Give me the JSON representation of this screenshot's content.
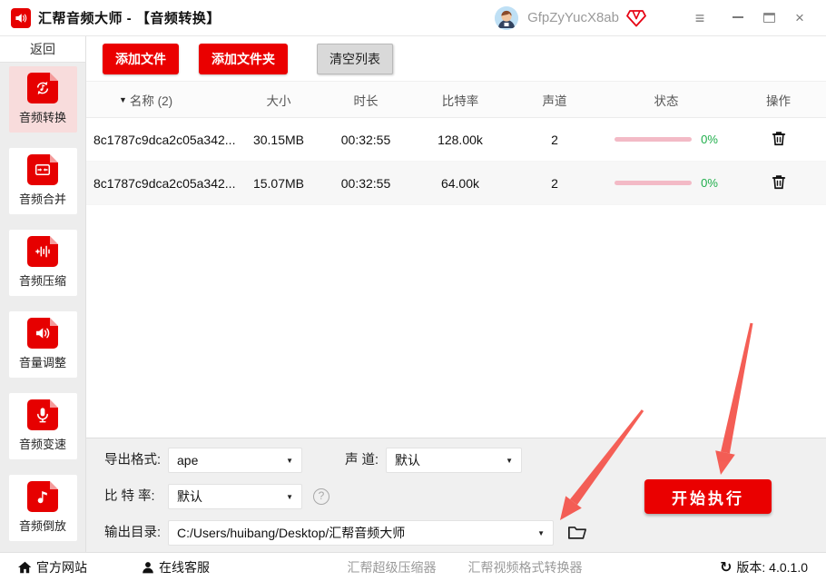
{
  "titlebar": {
    "app_title": "汇帮音频大师 - 【音频转换】",
    "username": "GfpZyYucX8ab"
  },
  "icons": {
    "menu": "≡",
    "close": "×",
    "sort_desc": "▼",
    "dropdown_caret": "▼",
    "help": "?",
    "refresh": "↻"
  },
  "sidebar": {
    "back_label": "返回",
    "items": [
      {
        "label": "音频转换",
        "active": true
      },
      {
        "label": "音频合并",
        "active": false
      },
      {
        "label": "音频压缩",
        "active": false
      },
      {
        "label": "音量调整",
        "active": false
      },
      {
        "label": "音频变速",
        "active": false
      },
      {
        "label": "音频倒放",
        "active": false
      }
    ]
  },
  "toolbar": {
    "add_file_label": "添加文件",
    "add_folder_label": "添加文件夹",
    "clear_list_label": "清空列表"
  },
  "table": {
    "headers": [
      "名称 (2)",
      "大小",
      "时长",
      "比特率",
      "声道",
      "状态",
      "操作"
    ],
    "rows": [
      {
        "name": "8c1787c9dca2c05a342...",
        "size": "30.15MB",
        "duration": "00:32:55",
        "bitrate": "128.00k",
        "channels": "2",
        "progress": 0,
        "progress_label": "0%"
      },
      {
        "name": "8c1787c9dca2c05a342...",
        "size": "15.07MB",
        "duration": "00:32:55",
        "bitrate": "64.00k",
        "channels": "2",
        "progress": 0,
        "progress_label": "0%"
      }
    ]
  },
  "settings": {
    "export_format_label": "导出格式:",
    "export_format_value": "ape",
    "channel_label": "声 道:",
    "channel_value": "默认",
    "bitrate_label": "比 特 率:",
    "bitrate_value": "默认",
    "output_dir_label": "输出目录:",
    "output_dir_value": "C:/Users/huibang/Desktop/汇帮音频大师",
    "start_button_label": "开始执行"
  },
  "statusbar": {
    "official_site": "官方网站",
    "online_service": "在线客服",
    "promo_link_1": "汇帮超级压缩器",
    "promo_link_2": "汇帮视频格式转换器",
    "version_text": "版本: 4.0.1.0"
  },
  "colors": {
    "primary_red": "#ea0000",
    "selected_item_bg": "#f8dcdc",
    "progress_track": "#f3bac6",
    "percent_green": "#1fae4b",
    "annotation_arrow": "#f4564d"
  }
}
